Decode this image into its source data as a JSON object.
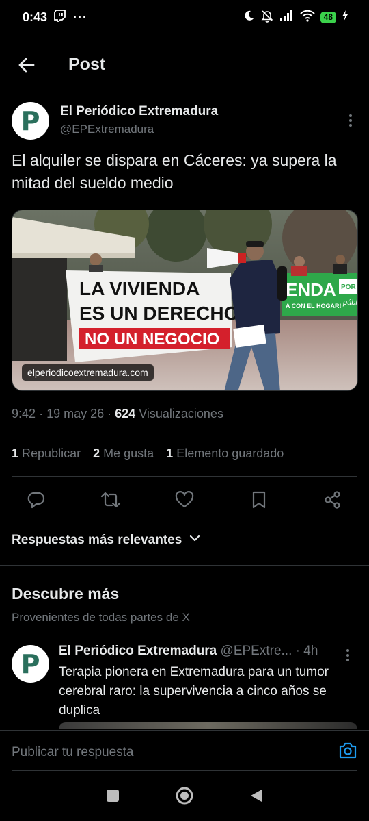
{
  "status_bar": {
    "time": "0:43",
    "battery": "48"
  },
  "header": {
    "title": "Post"
  },
  "post": {
    "author_name": "El Periódico Extremadura",
    "author_handle": "@EPExtremadura",
    "avatar_letter": "P",
    "text": "El alquiler se dispara en Cáceres: ya supera la mitad del sueldo medio",
    "media": {
      "caption": "elperiodicoextremadura.com",
      "banner_line1": "LA VIVIENDA",
      "banner_line2": "ES UN DERECHO",
      "banner_line3": "NO UN NEGOCIO",
      "green_banner_text": "ENDA",
      "green_banner_sub": "A CON EL HOGAR!",
      "green_banner_side": "POR",
      "green_banner_side2": "públ"
    },
    "time": "9:42",
    "date": "19 may 26",
    "views_count": "624",
    "views_label": "Visualizaciones",
    "stats": [
      {
        "count": "1",
        "label": "Republicar"
      },
      {
        "count": "2",
        "label": "Me gusta"
      },
      {
        "count": "1",
        "label": "Elemento guardado"
      }
    ]
  },
  "replies_sort": {
    "label": "Respuestas más relevantes"
  },
  "discover": {
    "title": "Descubre más",
    "subtitle": "Provenientes de todas partes de X",
    "post": {
      "author_name": "El Periódico Extremadura",
      "author_handle": "@EPExtre...",
      "time": "4h",
      "avatar_letter": "P",
      "text": "Terapia pionera en Extremadura para un tumor cerebral raro: la supervivencia a cinco años se duplica"
    }
  },
  "reply_bar": {
    "placeholder": "Publicar tu respuesta"
  },
  "colors": {
    "accent": "#1d9bf0",
    "background": "#000000",
    "muted": "#71767b",
    "battery": "#3bd14b"
  }
}
